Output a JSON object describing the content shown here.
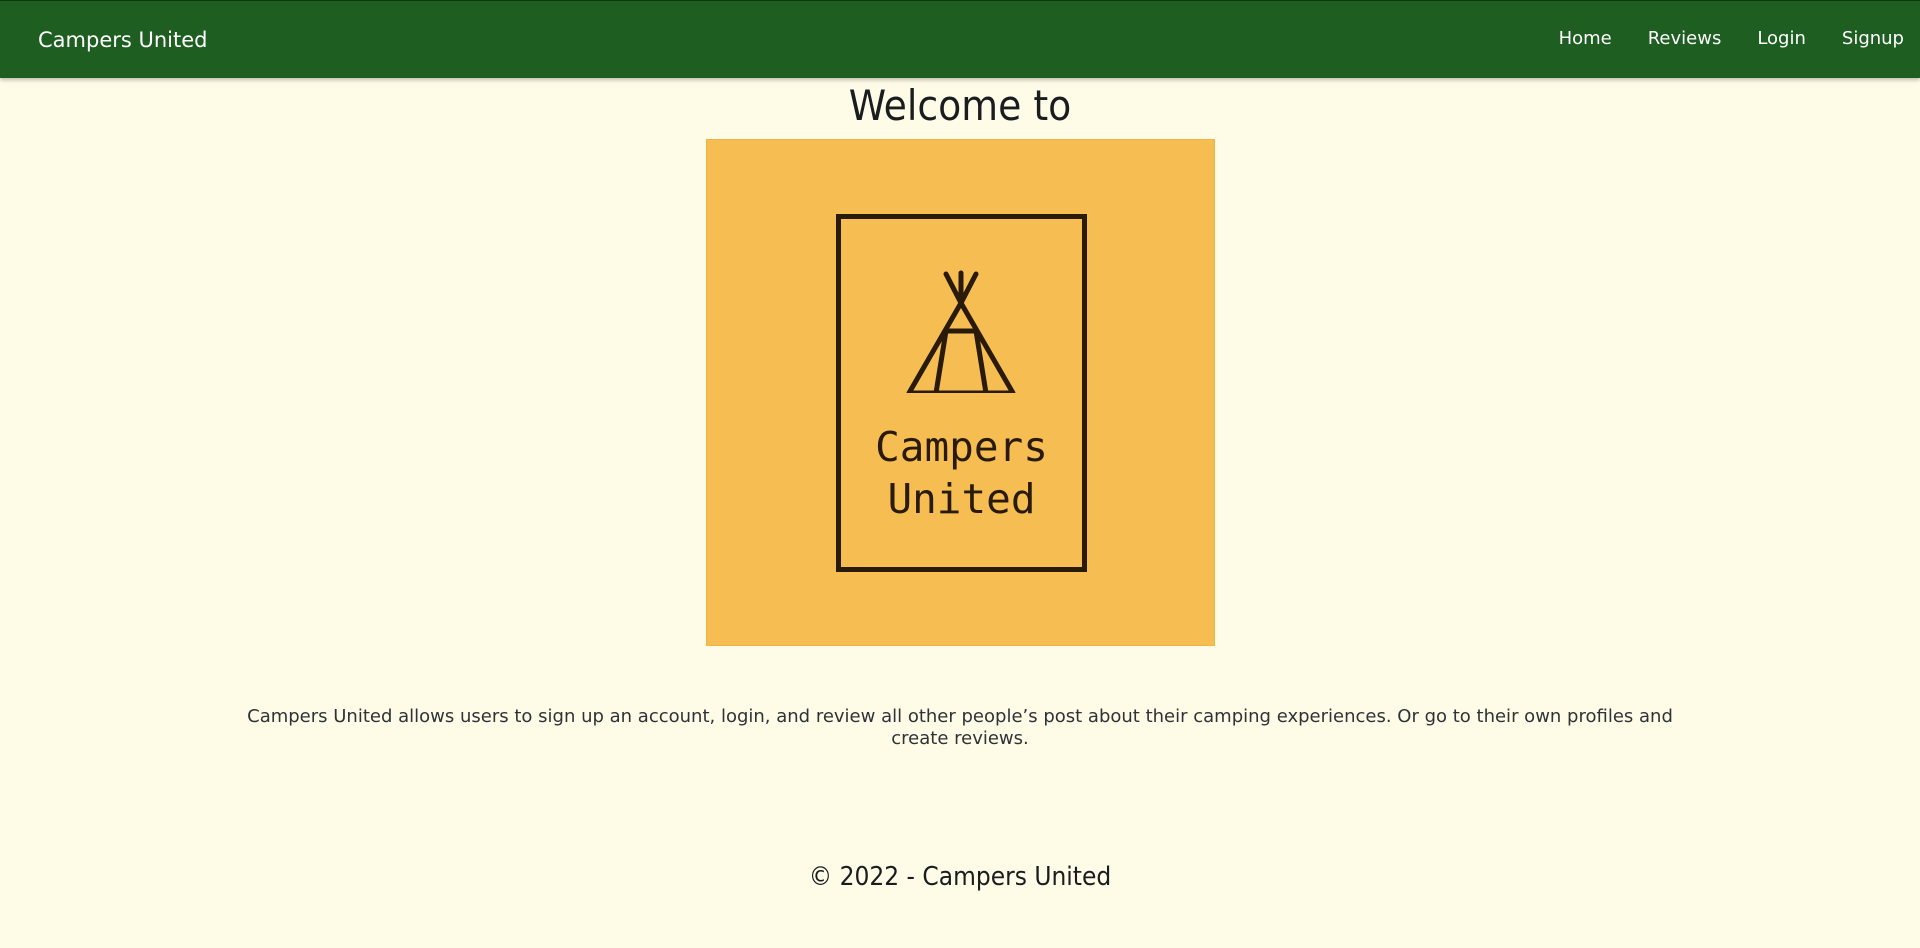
{
  "navbar": {
    "brand": "Campers United",
    "links": [
      "Home",
      "Reviews",
      "Login",
      "Signup"
    ]
  },
  "main": {
    "heading": "Welcome to",
    "logo": {
      "text_line1": "Campers",
      "text_line2": "United",
      "icon": "teepee-icon"
    },
    "description": "Campers United allows users to sign up an account, login, and review all other people’s post about their camping experiences. Or go to their own profiles and create reviews."
  },
  "footer": {
    "copyright": "© 2022 - Campers United"
  },
  "colors": {
    "navbar_bg": "#1e5e21",
    "page_bg": "#fefbe6",
    "logo_bg": "#f6be52",
    "logo_ink": "#2a1a08"
  }
}
